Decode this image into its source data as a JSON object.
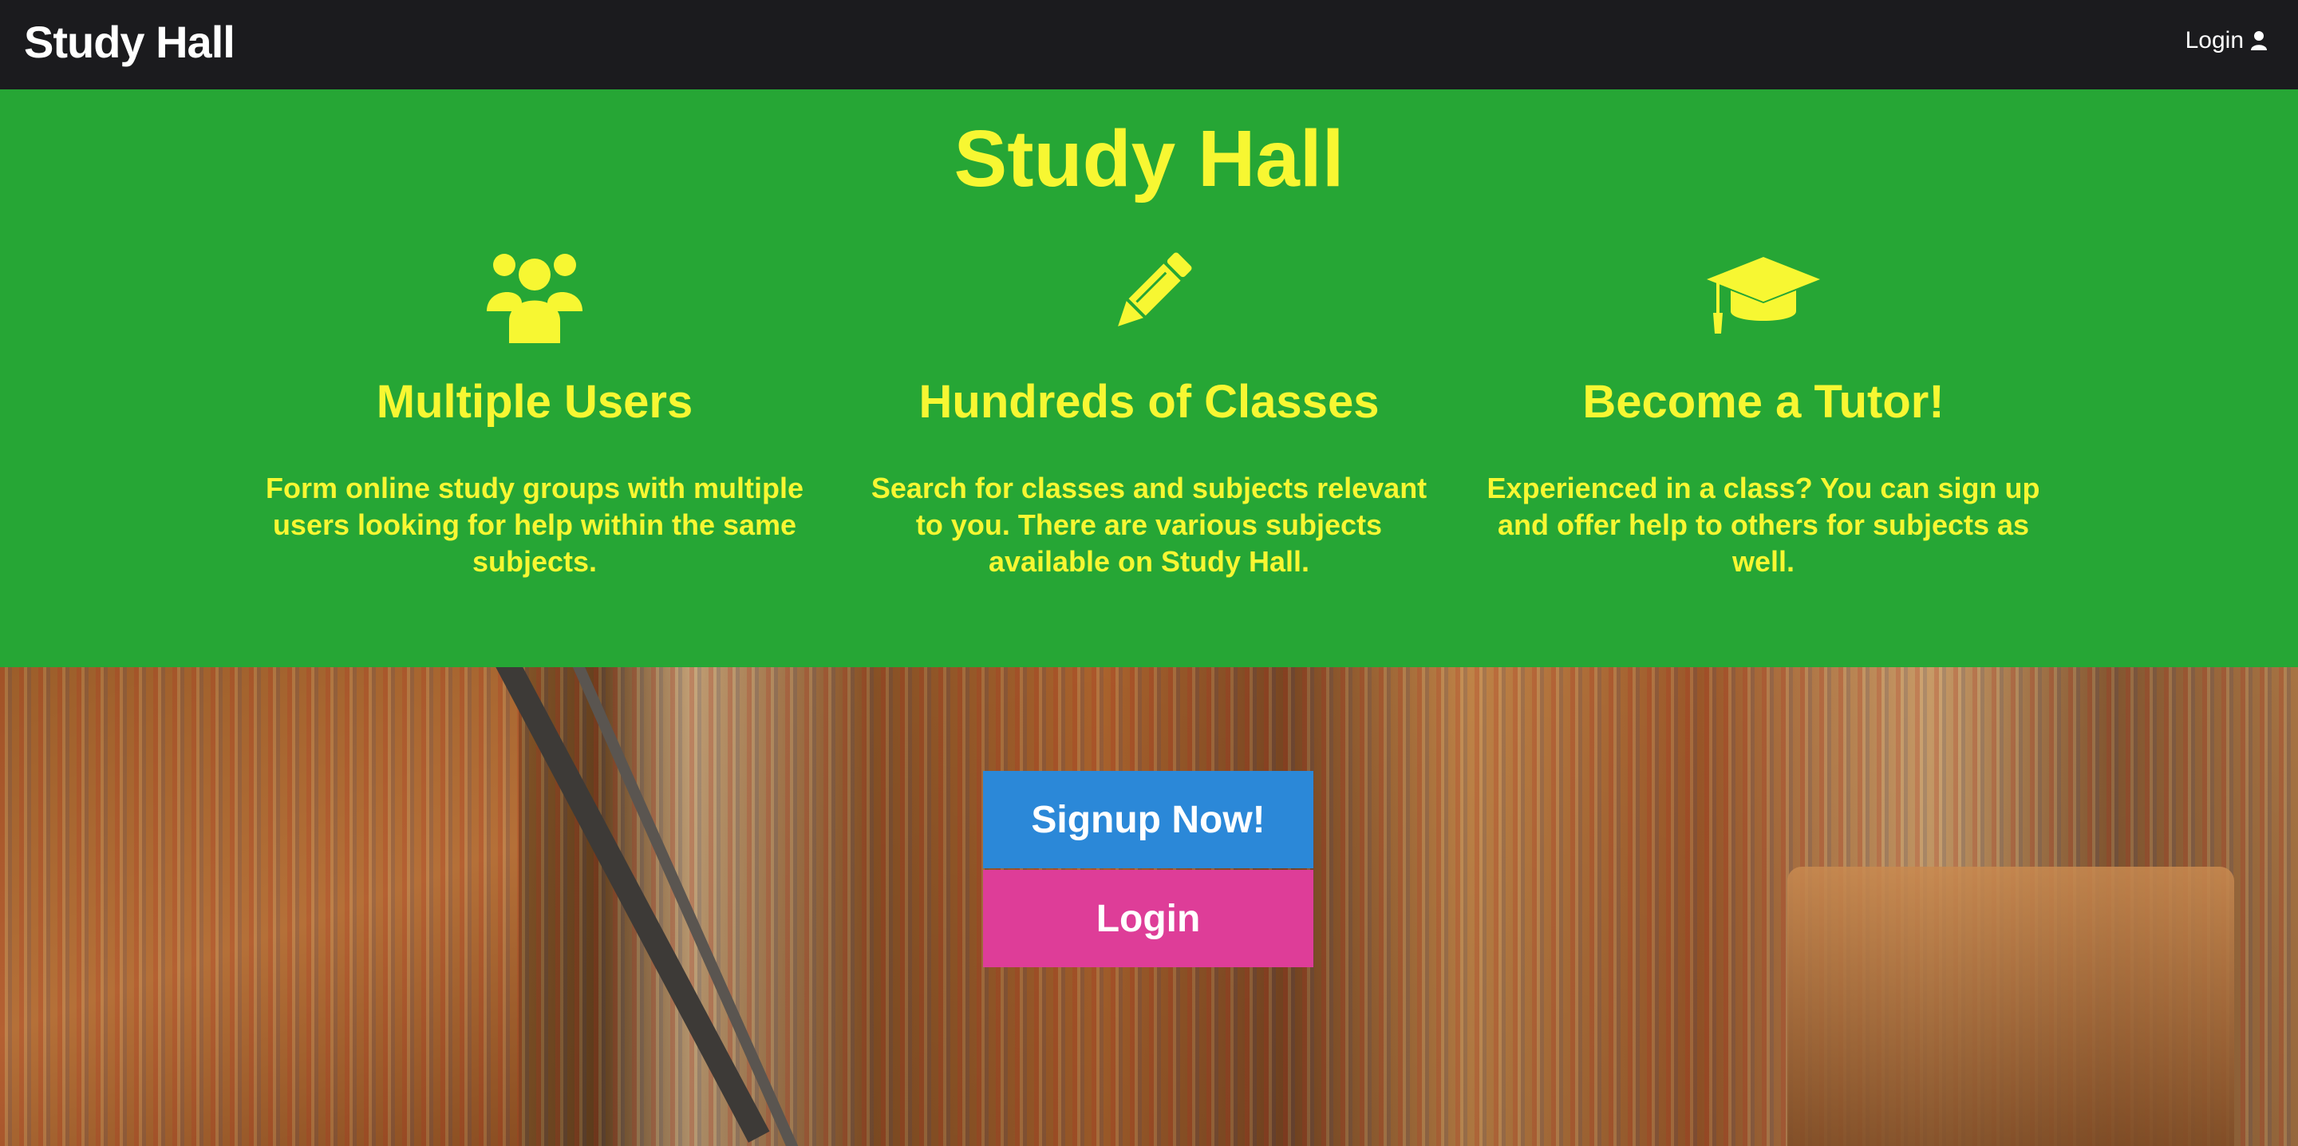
{
  "navbar": {
    "brand": "Study Hall",
    "login_label": "Login"
  },
  "hero": {
    "title": "Study Hall",
    "features": [
      {
        "icon": "users-icon",
        "title": "Multiple Users",
        "text": "Form online study groups with multiple users looking for help within the same subjects."
      },
      {
        "icon": "pencil-icon",
        "title": "Hundreds of Classes",
        "text": "Search for classes and subjects relevant to you. There are various subjects available on Study Hall."
      },
      {
        "icon": "graduation-cap-icon",
        "title": "Become a Tutor!",
        "text": "Experienced in a class? You can sign up and offer help to others for subjects as well."
      }
    ]
  },
  "cta": {
    "signup_label": "Signup Now!",
    "login_label": "Login"
  },
  "colors": {
    "navbar": "#1b1b1e",
    "hero": "#26a635",
    "accent_text": "#f7f732",
    "signup_button": "#2b88d8",
    "login_button": "#de3d98"
  }
}
